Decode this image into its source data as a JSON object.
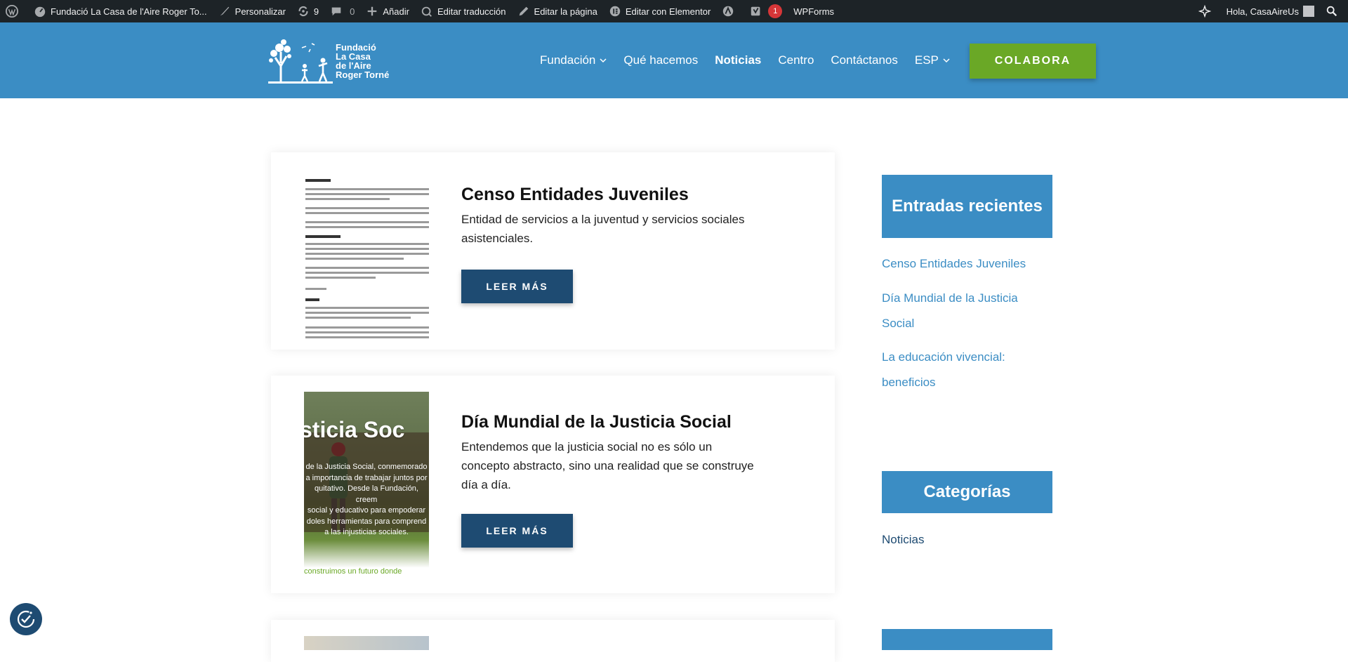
{
  "adminbar": {
    "site_title": "Fundació La Casa de l'Aire Roger To...",
    "customize": "Personalizar",
    "updates_count": "9",
    "comments_count": "0",
    "add_new": "Añadir",
    "edit_translation": "Editar traducción",
    "edit_page": "Editar la página",
    "edit_elementor": "Editar con Elementor",
    "seo_badge": "1",
    "wpforms": "WPForms",
    "greeting": "Hola, CasaAireUs"
  },
  "header": {
    "logo_lines": [
      "Fundació",
      "La Casa",
      "de l'Aire",
      "Roger Torné"
    ],
    "nav": [
      {
        "label": "Fundación",
        "has_dropdown": true,
        "active": false
      },
      {
        "label": "Qué hacemos",
        "has_dropdown": false,
        "active": false
      },
      {
        "label": "Noticias",
        "has_dropdown": false,
        "active": true
      },
      {
        "label": "Centro",
        "has_dropdown": false,
        "active": false
      },
      {
        "label": "Contáctanos",
        "has_dropdown": false,
        "active": false
      },
      {
        "label": "ESP",
        "has_dropdown": true,
        "active": false
      }
    ],
    "cta": "COLABORA",
    "colors": {
      "header_bg": "#3b8dc4",
      "cta_bg": "#6aa826"
    }
  },
  "posts": [
    {
      "title": "Censo Entidades Juveniles",
      "excerpt": "Entidad de servicios a la juventud y servicios sociales asistenciales.",
      "button": "LEER MÁS"
    },
    {
      "title": "Día Mundial de la Justicia Social",
      "excerpt": "Entendemos que la justicia social no es sólo un concepto abstracto, sino una realidad que se construye día a día.",
      "button": "LEER MÁS",
      "thumb_heading": "sticia Soc",
      "thumb_lines": [
        "de la Justicia Social, conmemorado",
        "a importancia de trabajar juntos por",
        "quitativo. Desde la Fundación, creem",
        "social y educativo para empoderar",
        "doles herramientas para comprend",
        "a las injusticias sociales."
      ],
      "thumb_footer": "construimos un futuro donde"
    }
  ],
  "sidebar": {
    "recent_title": "Entradas recientes",
    "recent_links": [
      "Censo Entidades Juveniles",
      "Día Mundial de la Justicia Social",
      "La educación vivencial: beneficios"
    ],
    "categories_title": "Categorías",
    "categories": [
      "Noticias"
    ]
  }
}
